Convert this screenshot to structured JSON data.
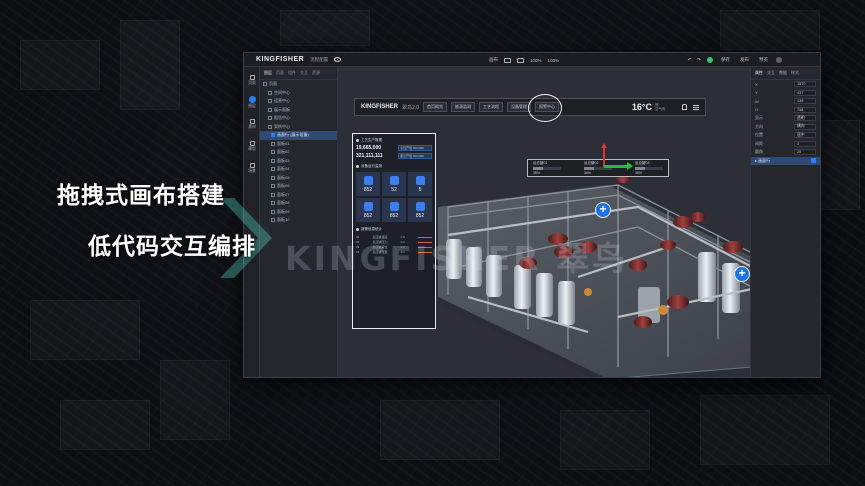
{
  "slogans": {
    "line1": "拖拽式画布搭建",
    "line2": "低代码交互编排"
  },
  "watermark": "KINGFISHER 翠鸟",
  "app": {
    "brand": "KINGFISHER",
    "project_name": "流程配置",
    "topbar": {
      "center_items": [
        "画布",
        "100%",
        "100%"
      ],
      "right_items": [
        "",
        "",
        "保存",
        "发布",
        "预览"
      ]
    },
    "rail": [
      {
        "label": "页面"
      },
      {
        "label": "图层"
      },
      {
        "label": "素材"
      },
      {
        "label": "模型"
      },
      {
        "label": "场景"
      }
    ],
    "tree": {
      "tabs": [
        "图层",
        "页面",
        "组件",
        "交互",
        "资源"
      ],
      "rows": [
        "页面",
        "空间中心",
        "运营中心",
        "展示面板",
        "报告中心",
        "案例中心",
        "画面行 (展示设备)",
        "面板01",
        "面板02",
        "面板03",
        "面板04",
        "面板05",
        "面板06",
        "面板07",
        "面板08",
        "面板09",
        "面板10"
      ],
      "selected_index": 6
    },
    "props": {
      "tabs": [
        "属性",
        "交互",
        "数据",
        "样式"
      ],
      "rows": [
        {
          "label": "X",
          "value": "1570"
        },
        {
          "label": "Y",
          "value": "437"
        },
        {
          "label": "W",
          "value": "139"
        },
        {
          "label": "H",
          "value": "758"
        }
      ],
      "sections": [
        {
          "label": "显示",
          "value": "透明"
        },
        {
          "label": "方向",
          "value": "横向"
        },
        {
          "label": "位置",
          "value": "居中"
        },
        {
          "label": "间距",
          "value": "3"
        },
        {
          "label": "圆角",
          "value": "25"
        }
      ],
      "highlight": "▸ 画面行"
    },
    "canvas": {
      "preview_bar": {
        "logo": "KINGFISHER",
        "version": "翠鸟2.0",
        "tabs": [
          "首页概览",
          "能源监测",
          "工艺流程",
          "设备管理",
          "报警中心"
        ],
        "temperature": "16°C",
        "weather_lines": [
          "晴",
          "空气优"
        ]
      },
      "dashboard": {
        "header": "工艺生产数据",
        "kpis": [
          {
            "value": "19,665,000",
            "tag": "今日产量 000,000"
          },
          {
            "value": "321,111,111",
            "tag": "累计产量 000,000"
          }
        ],
        "section2": "设备运行监测",
        "tiles": [
          {
            "icon": "tank-icon",
            "value": "852"
          },
          {
            "icon": "bell-icon",
            "value": "52"
          },
          {
            "icon": "pin-icon",
            "value": "5"
          },
          {
            "icon": "wifi-icon",
            "value": "852"
          },
          {
            "icon": "chart-icon",
            "value": "852"
          },
          {
            "icon": "box-icon",
            "value": "852"
          }
        ],
        "section3": "报警信息统计",
        "table_rows": [
          {
            "a": "01",
            "b": "反应罐温度",
            "c": "0.5"
          },
          {
            "a": "02",
            "b": "反应罐压力",
            "c": "0.3"
          },
          {
            "a": "03",
            "b": "反应罐液位",
            "c": "0.2"
          },
          {
            "a": "04",
            "b": "反应罐流量",
            "c": "0.1"
          }
        ]
      },
      "gauge": [
        {
          "label": "反应罐01",
          "value": "36%",
          "fill": 0.36
        },
        {
          "label": "反应罐02",
          "value": "36%",
          "fill": 0.36
        },
        {
          "label": "反应罐03",
          "value": "36%",
          "fill": 0.36
        }
      ]
    }
  },
  "colors": {
    "accent": "#2f7cf6",
    "axis_x": "#20c03a",
    "axis_y": "#e03131",
    "status_online": "#34c26a"
  }
}
